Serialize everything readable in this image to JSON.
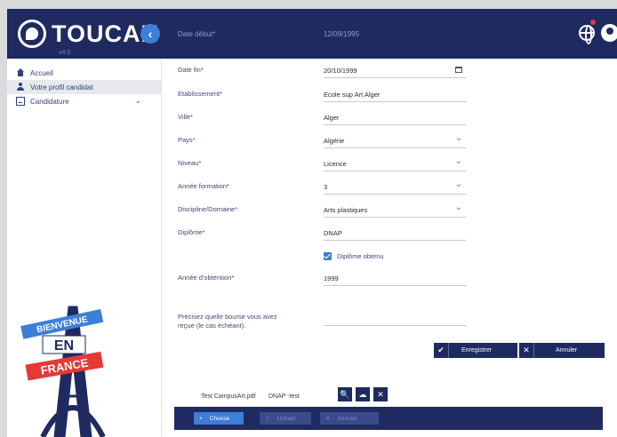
{
  "header": {
    "logo_text": "TOUCAN",
    "logo_sub": "v4.0",
    "collapse_glyph": "‹",
    "ghost_label": "Date début*",
    "ghost_value": "12/09/1995"
  },
  "sidebar": {
    "items": [
      {
        "label": "Accueil",
        "icon": "home-icon"
      },
      {
        "label": "Votre profil candidat",
        "icon": "person-icon"
      },
      {
        "label": "Candidature",
        "icon": "document-icon"
      }
    ]
  },
  "banner": {
    "line1": "BIENVENUE",
    "line2": "EN",
    "line3": "FRANCE"
  },
  "form": {
    "fields": [
      {
        "label": "Date fin",
        "value": "20/10/1999"
      },
      {
        "label": "Etablissement",
        "value": "Ecole sup Art Alger"
      },
      {
        "label": "Ville",
        "value": "Alger"
      },
      {
        "label": "Pays",
        "value": "Algérie"
      },
      {
        "label": "Niveau",
        "value": "Licence"
      },
      {
        "label": "Année formation",
        "value": "3"
      },
      {
        "label": "Discipline/Domaine",
        "value": "Arts plastiques"
      },
      {
        "label": "Diplôme",
        "value": "DNAP"
      }
    ],
    "required_mark": "*",
    "checkbox_label": "Diplôme obtenu",
    "year_label": "Année d'obtention",
    "year_value": "1999",
    "bourse_label_1": "Précisez quelle bourse vous avez",
    "bourse_label_2": "reçue (le cas échéant).",
    "save_label": "Enregistrer",
    "cancel_label": "Annuler",
    "check_glyph": "✔",
    "cross_glyph": "✕"
  },
  "attachment": {
    "file_name": "Test CampusArt.pdf",
    "file_desc": "DNAP -test",
    "search_glyph": "🔍",
    "cloud_glyph": "☁",
    "remove_glyph": "✕"
  },
  "uploader": {
    "choose_label": "Choose",
    "upload_label": "Upload",
    "cancel_label": "Annuler",
    "plus_glyph": "+",
    "up_glyph": "⇧",
    "x_glyph": "✕"
  },
  "colors": {
    "header": "#1e2a60",
    "accent": "#3b7fd6",
    "required": "#d23b3b"
  }
}
